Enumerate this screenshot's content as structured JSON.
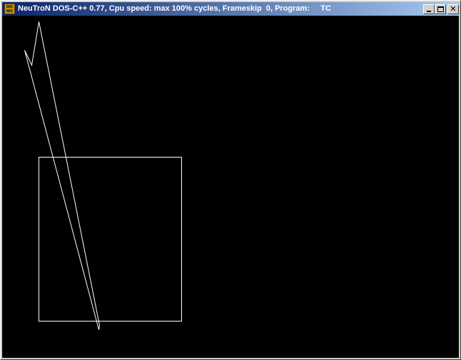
{
  "window": {
    "title": "NeuTroN DOS-C++ 0.77, Cpu speed: max 100% cycles, Frameskip  0, Program:     TC",
    "icon": "dosbox-icon",
    "icon_text": "DOS BOX",
    "buttons": {
      "minimize": "minimize-icon",
      "maximize": "maximize-icon",
      "close": "close-icon"
    }
  },
  "colors": {
    "titlebar_start": "#0a246a",
    "titlebar_end": "#a6caf0",
    "screen_bg": "#000000",
    "stroke": "#ffffff"
  }
}
